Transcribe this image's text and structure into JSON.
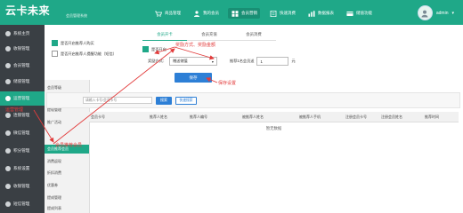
{
  "app": {
    "logo": "云卡未来",
    "logo_sub": "会员管理系统"
  },
  "topnav": [
    {
      "label": "商品管理",
      "icon": "cart-icon",
      "active": false
    },
    {
      "label": "我的会员",
      "icon": "member-icon",
      "active": false
    },
    {
      "label": "会员营销",
      "icon": "grid-icon",
      "active": true
    },
    {
      "label": "快速消费",
      "icon": "book-icon",
      "active": false
    },
    {
      "label": "数据报表",
      "icon": "chart-icon",
      "active": false
    },
    {
      "label": "储值功能",
      "icon": "card-icon",
      "active": false
    }
  ],
  "user": {
    "name": "admin",
    "caret": "▾"
  },
  "sidebar": [
    {
      "label": "系统主页",
      "active": false
    },
    {
      "label": "收银管理",
      "active": false
    },
    {
      "label": "会员管理",
      "active": false
    },
    {
      "label": "储值管理",
      "active": false
    },
    {
      "label": "运营管理",
      "active": true
    },
    {
      "label": "连锁管理",
      "active": false
    },
    {
      "label": "微信管理",
      "active": false
    },
    {
      "label": "积分管理",
      "active": false
    },
    {
      "label": "系统设置",
      "active": false
    },
    {
      "label": "收银管理",
      "active": false
    },
    {
      "label": "短信管理",
      "active": false
    }
  ],
  "submenu": [
    {
      "label": "会员等级",
      "active": false
    },
    {
      "label": "等级升级管理",
      "active": false
    },
    {
      "label": "提现管理",
      "active": false
    },
    {
      "label": "推广活动",
      "active": false
    },
    {
      "label": "会员推荐会员",
      "active": true
    },
    {
      "label": "消费返现",
      "active": false
    },
    {
      "label": "折扣消费",
      "active": false
    },
    {
      "label": "优惠券",
      "active": false
    },
    {
      "label": "提成管理",
      "active": false
    },
    {
      "label": "提成列表",
      "active": false
    }
  ],
  "settings_panel": {
    "opt1": "是否开启推荐人购买",
    "opt2": "是否开启推荐人提醒功能（短信）"
  },
  "tabs": [
    "会员开卡",
    "会员充值",
    "会员消费"
  ],
  "form": {
    "enable_label": "是否开启",
    "reward_label": "奖励方式：",
    "reward_value": "赠送储值",
    "reward_caret": "▾",
    "amount_label": "推荐1名会员送",
    "amount_value": "1",
    "unit": "元",
    "save": "保存"
  },
  "annotations": {
    "a1": "奖励方式、奖励金额",
    "a2": "保存设置",
    "a3": "会员推荐会员",
    "a4": "运营管理"
  },
  "search": {
    "placeholder": "请输入卡号/会员卡号",
    "button": "搜索",
    "button2": "快速搜索"
  },
  "table": {
    "columns": [
      "会员卡号",
      "推荐人姓名",
      "推荐人编号",
      "被推荐人姓名",
      "被推荐人手机",
      "注册会员卡号",
      "注册会员姓名",
      "推荐时间"
    ],
    "empty": "暂无数据"
  },
  "colors": {
    "brand": "#1fa888",
    "sidebar": "#3a3f44",
    "primary": "#2d7fd6",
    "annotation": "#e23b3b"
  }
}
